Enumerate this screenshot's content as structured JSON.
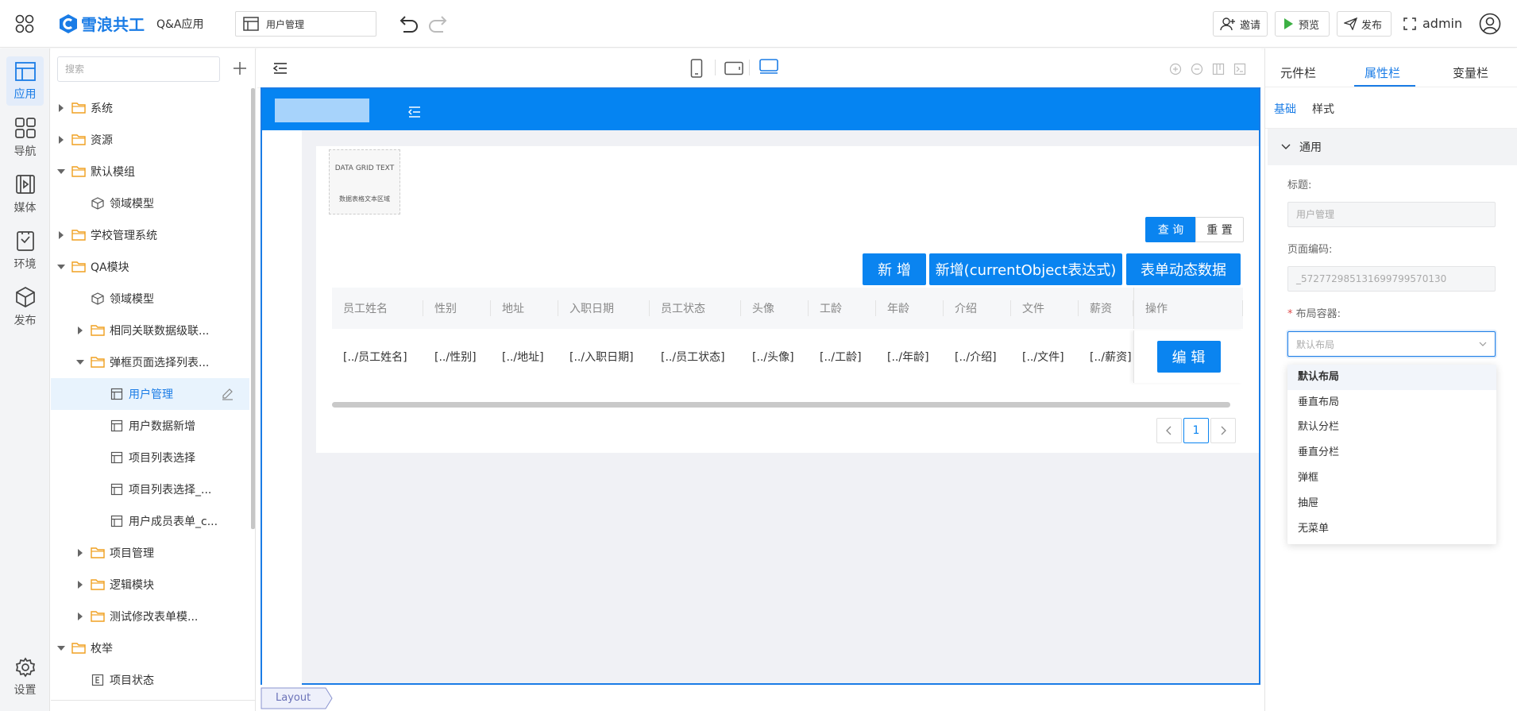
{
  "app": {
    "brand_name": "雪浪共工",
    "app_name": "Q&A应用",
    "current_page": "用户管理",
    "brand_color": "#1a7ce6"
  },
  "topbar": {
    "invite": "邀请",
    "preview": "预览",
    "publish": "发布",
    "user": "admin"
  },
  "rail": {
    "items": [
      {
        "label": "应用",
        "icon": "app-layout-icon",
        "active": true
      },
      {
        "label": "导航",
        "icon": "grid-nav-icon"
      },
      {
        "label": "媒体",
        "icon": "media-icon"
      },
      {
        "label": "环境",
        "icon": "env-icon"
      },
      {
        "label": "发布",
        "icon": "cube-icon"
      }
    ],
    "settings": "设置"
  },
  "tree": {
    "search_placeholder": "搜索",
    "rows": [
      {
        "label": "系统",
        "type": "folder",
        "level": 0,
        "expanded": false
      },
      {
        "label": "资源",
        "type": "folder",
        "level": 0,
        "expanded": false
      },
      {
        "label": "默认模组",
        "type": "folder",
        "level": 0,
        "expanded": true
      },
      {
        "label": "领域模型",
        "type": "model",
        "level": 1
      },
      {
        "label": "学校管理系统",
        "type": "folder",
        "level": 0,
        "expanded": false
      },
      {
        "label": "QA模块",
        "type": "folder",
        "level": 0,
        "expanded": true
      },
      {
        "label": "领域模型",
        "type": "model",
        "level": 1
      },
      {
        "label": "相同关联数据级联...",
        "type": "folder",
        "level": 1,
        "expanded": false
      },
      {
        "label": "弹框页面选择列表...",
        "type": "folder",
        "level": 1,
        "expanded": true
      },
      {
        "label": "用户管理",
        "type": "page",
        "level": 2,
        "selected": true
      },
      {
        "label": "用户数据新增",
        "type": "page",
        "level": 2
      },
      {
        "label": "项目列表选择",
        "type": "page",
        "level": 2
      },
      {
        "label": "项目列表选择_...",
        "type": "page",
        "level": 2
      },
      {
        "label": "用户成员表单_c...",
        "type": "page",
        "level": 2
      },
      {
        "label": "项目管理",
        "type": "folder",
        "level": 1,
        "expanded": false
      },
      {
        "label": "逻辑模块",
        "type": "folder",
        "level": 1,
        "expanded": false
      },
      {
        "label": "测试修改表单模...",
        "type": "folder",
        "level": 1,
        "expanded": false
      },
      {
        "label": "枚举",
        "type": "folder",
        "level": 0,
        "expanded": true
      },
      {
        "label": "项目状态",
        "type": "enum",
        "level": 1
      }
    ]
  },
  "canvas": {
    "grid_text_title": "DATA GRID TEXT",
    "grid_text_sub": "数据表格文本区域",
    "query": "查 询",
    "reset": "重 置",
    "add": "新 增",
    "add_expr": "新增(currentObject表达式)",
    "form_dynamic": "表单动态数据",
    "columns": [
      "员工姓名",
      "性别",
      "地址",
      "入职日期",
      "员工状态",
      "头像",
      "工龄",
      "年龄",
      "介绍",
      "文件",
      "薪资",
      "操作"
    ],
    "row": [
      "[../员工姓名]",
      "[../性别]",
      "[../地址]",
      "[../入职日期]",
      "[../员工状态]",
      "[../头像]",
      "[../工龄]",
      "[../年龄]",
      "[../介绍]",
      "[../文件]",
      "[../薪资]"
    ],
    "edit": "编 辑",
    "page": "1",
    "breadcrumb": "Layout"
  },
  "right": {
    "tabs": [
      "元件栏",
      "属性栏",
      "变量栏"
    ],
    "subtabs": [
      "基础",
      "样式"
    ],
    "section": "通用",
    "title_label": "标题:",
    "title_value": "用户管理",
    "code_label": "页面编码:",
    "code_value": "_572772985131699799570130",
    "layout_label": "布局容器:",
    "layout_placeholder": "默认布局",
    "options": [
      "默认布局",
      "垂直布局",
      "默认分栏",
      "垂直分栏",
      "弹框",
      "抽屉",
      "无菜单"
    ]
  }
}
